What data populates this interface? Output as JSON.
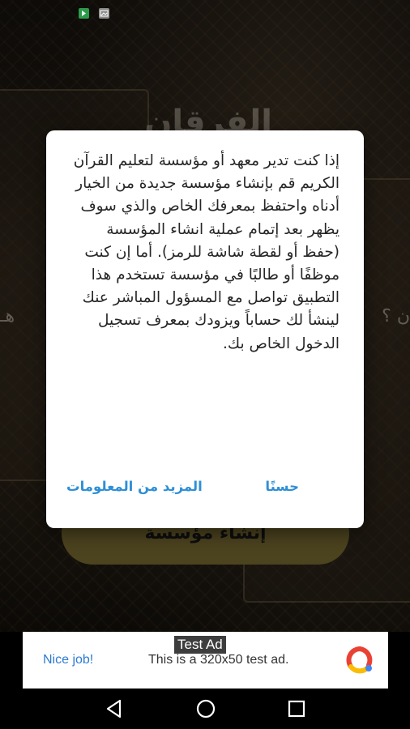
{
  "background": {
    "app_title": "الفرقان",
    "question_left_fragment": "هـ",
    "question_right_fragment": "ن ؟",
    "create_institution_button": "إنشاء مؤسسة"
  },
  "dialog": {
    "message": "إذا كنت تدير معهد أو مؤسسة لتعليم القرآن الكريم قم بإنشاء مؤسسة جديدة من الخيار أدناه واحتفظ بمعرفك الخاص والذي سوف يظهر بعد إتمام عملية انشاء المؤسسة (حفظ أو لقطة شاشة للرمز). أما إن كنت موظفًا أو طالبًا في مؤسسة تستخدم هذا التطبيق تواصل مع المسؤول المباشر عنك لينشأ لك حساباً ويزودك بمعرف تسجيل الدخول الخاص بك.",
    "ok_label": "حسنًا",
    "more_info_label": "المزيد من المعلومات"
  },
  "ad": {
    "tag": "Test Ad",
    "nice_job": "Nice job!",
    "text": "This is a 320x50 test ad."
  },
  "colors": {
    "accent_blue": "#2e8fd6",
    "button_gold": "#8a7a3a"
  }
}
